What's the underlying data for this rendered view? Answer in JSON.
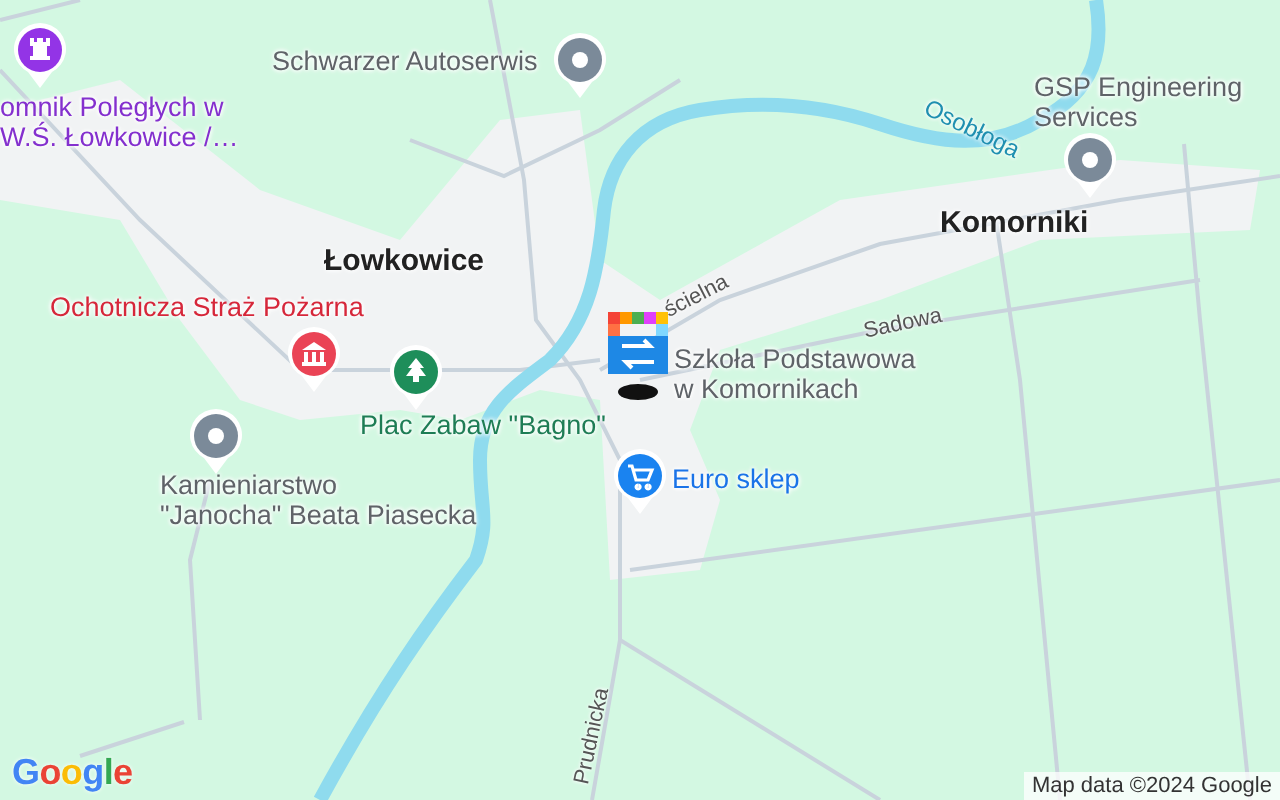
{
  "map": {
    "places": [
      {
        "kind": "monument",
        "lines": [
          "omnik Poległych w",
          "W.Ś. Łowkowice /…"
        ]
      },
      {
        "kind": "generic",
        "lines": [
          "Schwarzer Autoserwis"
        ]
      },
      {
        "kind": "generic",
        "lines": [
          "GSP Engineering",
          "Services"
        ]
      },
      {
        "kind": "fire-station",
        "lines": [
          "Ochotnicza Straż Pożarna"
        ]
      },
      {
        "kind": "park",
        "lines": [
          "Plac Zabaw \"Bagno\""
        ]
      },
      {
        "kind": "generic",
        "lines": [
          "Kamieniarstwo",
          "\"Janocha\" Beata Piasecka"
        ]
      },
      {
        "kind": "school",
        "lines": [
          "Szkoła Podstawowa",
          "w Komornikach"
        ]
      },
      {
        "kind": "shop",
        "lines": [
          "Euro sklep"
        ]
      }
    ],
    "towns": [
      "Łowkowice",
      "Komorniki"
    ],
    "streets": [
      "ścielna",
      "Sadowa",
      "Prudnicka"
    ],
    "river": "Osobłoga",
    "logo": "Google",
    "attribution": "Map data ©2024 Google"
  }
}
